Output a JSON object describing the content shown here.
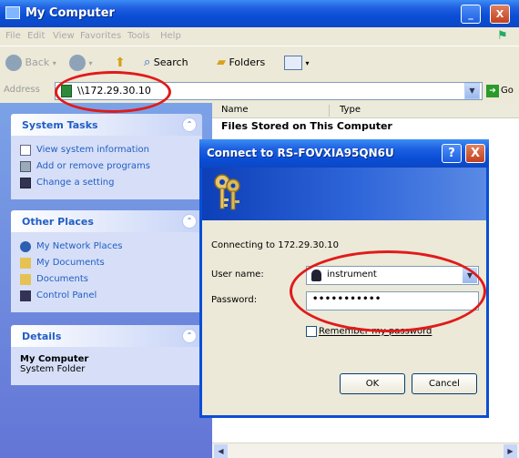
{
  "window": {
    "title": "My Computer",
    "minimize_glyph": "_",
    "close_glyph": "X"
  },
  "menubar": {
    "items": [
      "File",
      "Edit",
      "View",
      "Favorites",
      "Tools",
      "Help"
    ]
  },
  "toolbar": {
    "back_label": "Back",
    "search_label": "Search",
    "folders_label": "Folders"
  },
  "address": {
    "label": "Address",
    "value": "\\\\172.29.30.10",
    "go_label": "Go"
  },
  "left_pane": {
    "system_tasks": {
      "title": "System Tasks",
      "items": [
        {
          "label": "View system information",
          "icon": "info-icon"
        },
        {
          "label": "Add or remove programs",
          "icon": "programs-icon"
        },
        {
          "label": "Change a setting",
          "icon": "control-icon"
        }
      ]
    },
    "other_places": {
      "title": "Other Places",
      "items": [
        {
          "label": "My Network Places",
          "icon": "network-icon"
        },
        {
          "label": "My Documents",
          "icon": "folder-icon"
        },
        {
          "label": "Documents",
          "icon": "folder-icon"
        },
        {
          "label": "Control Panel",
          "icon": "control-icon"
        }
      ]
    },
    "details": {
      "title": "Details",
      "name": "My Computer",
      "type": "System Folder"
    }
  },
  "main": {
    "columns": [
      "Name",
      "Type"
    ],
    "group_heading": "Files Stored on This Computer"
  },
  "dialog": {
    "title": "Connect to RS-FOVXIA95QN6U",
    "help_glyph": "?",
    "close_glyph": "X",
    "connecting_text": "Connecting to 172.29.30.10",
    "username_label": "User name:",
    "username_value": "instrument",
    "password_label": "Password:",
    "password_value": "•••••••••••",
    "remember_label": "Remember my password",
    "ok_label": "OK",
    "cancel_label": "Cancel"
  },
  "colors": {
    "xp_blue": "#0a4ed6",
    "task_pane_link": "#215dc6",
    "annotation_red": "#e01b1b"
  }
}
